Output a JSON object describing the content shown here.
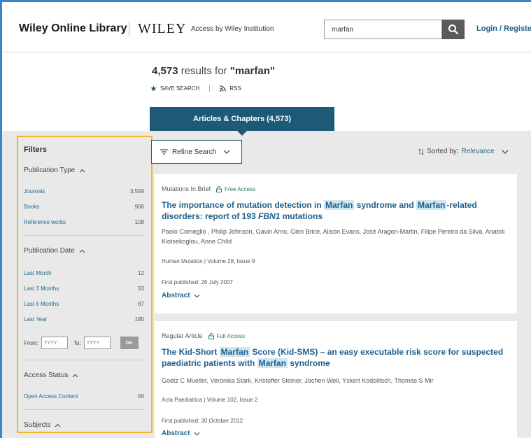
{
  "header": {
    "brand": "Wiley Online Library",
    "wiley": "WILEY",
    "access": "Access by Wiley Institution",
    "search_value": "marfan",
    "login": "Login / Register"
  },
  "results": {
    "count": "4,573",
    "results_for": " results for ",
    "query": "\"marfan\"",
    "save_search": "SAVE SEARCH",
    "rss": "RSS"
  },
  "tab": {
    "label": "Articles & Chapters (4,573)"
  },
  "filters": {
    "title": "Filters",
    "publication_type": {
      "label": "Publication Type",
      "items": [
        {
          "label": "Journals",
          "count": "3,559"
        },
        {
          "label": "Books",
          "count": "906"
        },
        {
          "label": "Reference works",
          "count": "108"
        }
      ]
    },
    "publication_date": {
      "label": "Publication Date",
      "items": [
        {
          "label": "Last Month",
          "count": "12"
        },
        {
          "label": "Last 3 Months",
          "count": "53"
        },
        {
          "label": "Last 6 Months",
          "count": "87"
        },
        {
          "label": "Last Year",
          "count": "185"
        }
      ],
      "from_label": "From:",
      "to_label": "To:",
      "from_placeholder": "YYYY",
      "to_placeholder": "YYYY",
      "go": "Go"
    },
    "access_status": {
      "label": "Access Status",
      "items": [
        {
          "label": "Open Access Content",
          "count": "56"
        }
      ]
    },
    "subjects": {
      "label": "Subjects"
    }
  },
  "toolbar": {
    "refine": "Refine Search",
    "sorted_by": "Sorted by:",
    "sort_value": "Relevance"
  },
  "cards": [
    {
      "kind": "Mutations In Brief",
      "access": "Free Access",
      "title_parts": [
        "The importance of mutation detection in ",
        "Marfan",
        " syndrome and ",
        "Marfan",
        "-related disorders: report of 193 ",
        "FBN1",
        " mutations"
      ],
      "authors": "Paolo Comeglio , Philip Johnson, Gavin Arno, Glen Brice, Alison Evans, José Aragon-Martin, Filipe Pereira da Silva, Anatoli Kiotsekoglou, Anne Child",
      "journal": "Human Mutation | Volume 28, Issue 9",
      "published": "First published: 26 July 2007",
      "abstract": "Abstract"
    },
    {
      "kind": "Regular Article",
      "access": "Full Access",
      "title_parts": [
        "The Kid-Short ",
        "Marfan",
        " Score (Kid-SMS) – an easy executable risk score for suspected paediatric patients with ",
        "Marfan",
        " syndrome"
      ],
      "authors": "Goetz C Mueller, Veronika Stark, Kristoffer Steiner, Jochen Weil, Yskert Kodolitsch, Thomas S Mir",
      "journal": "Acta Paediatrica | Volume 102, Issue 2",
      "published": "First published: 30 October 2012",
      "abstract": "Abstract"
    }
  ]
}
